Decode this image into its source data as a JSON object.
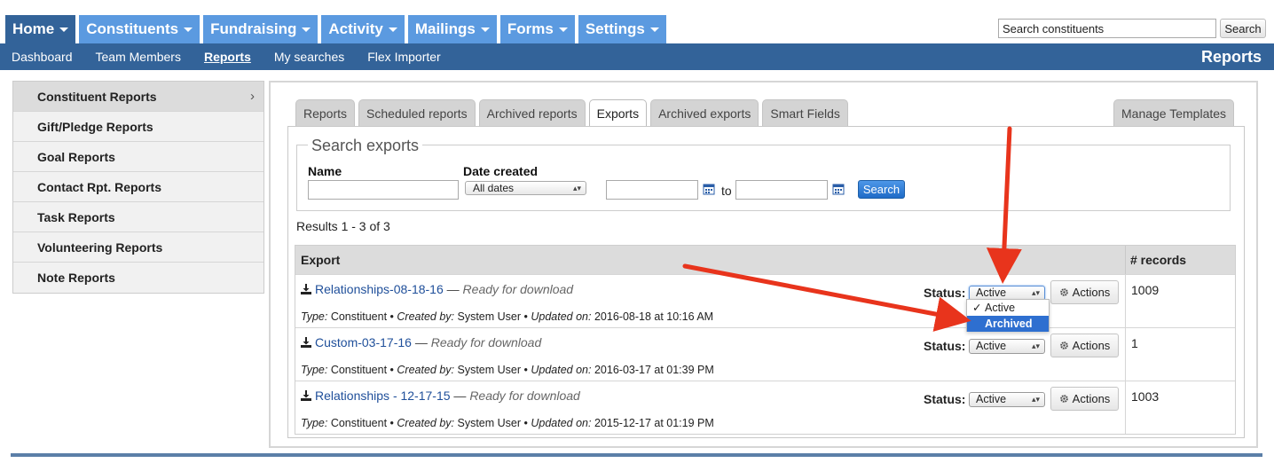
{
  "main_nav": {
    "tabs": [
      {
        "label": "Home",
        "active": true
      },
      {
        "label": "Constituents",
        "active": false
      },
      {
        "label": "Fundraising",
        "active": false
      },
      {
        "label": "Activity",
        "active": false
      },
      {
        "label": "Mailings",
        "active": false
      },
      {
        "label": "Forms",
        "active": false
      },
      {
        "label": "Settings",
        "active": false
      }
    ],
    "search_value": "Search constituents",
    "search_button": "Search"
  },
  "sub_nav": {
    "links": [
      "Dashboard",
      "Team Members",
      "Reports",
      "My searches",
      "Flex Importer"
    ],
    "active": "Reports",
    "title": "Reports"
  },
  "sidebar": {
    "items": [
      {
        "label": "Constituent Reports",
        "active": true,
        "chevron": "›"
      },
      {
        "label": "Gift/Pledge Reports",
        "active": false
      },
      {
        "label": "Goal Reports",
        "active": false
      },
      {
        "label": "Contact Rpt. Reports",
        "active": false
      },
      {
        "label": "Task Reports",
        "active": false
      },
      {
        "label": "Volunteering Reports",
        "active": false
      },
      {
        "label": "Note Reports",
        "active": false
      }
    ]
  },
  "tabs": {
    "items": [
      "Reports",
      "Scheduled reports",
      "Archived reports",
      "Exports",
      "Archived exports",
      "Smart Fields"
    ],
    "active": "Exports",
    "right": "Manage Templates"
  },
  "search_exports": {
    "legend": "Search exports",
    "name_label": "Name",
    "date_label": "Date created",
    "date_select": "All dates",
    "to_label": "to",
    "button": "Search"
  },
  "results_text": "Results 1 - 3 of 3",
  "table": {
    "col_export": "Export",
    "col_records": "# records",
    "status_label": "Status:",
    "actions_label": "Actions",
    "meta_labels": {
      "type": "Type:",
      "created_by": "Created by:",
      "updated_on": "Updated on:"
    },
    "rows": [
      {
        "name": "Relationships-08-18-16",
        "status_text": "Ready for download",
        "type": "Constituent",
        "created_by": "System User",
        "updated_on": "2016-08-18 at 10:16 AM",
        "status_value": "Active",
        "records": "1009"
      },
      {
        "name": "Custom-03-17-16",
        "status_text": "Ready for download",
        "type": "Constituent",
        "created_by": "System User",
        "updated_on": "2016-03-17 at 01:39 PM",
        "status_value": "Active",
        "records": "1"
      },
      {
        "name": "Relationships - 12-17-15",
        "status_text": "Ready for download",
        "type": "Constituent",
        "created_by": "System User",
        "updated_on": "2015-12-17 at 01:19 PM",
        "status_value": "Active",
        "records": "1003"
      }
    ]
  },
  "status_dropdown": {
    "options": [
      {
        "label": "Active",
        "checked": true
      },
      {
        "label": "Archived",
        "highlighted": true
      }
    ]
  },
  "colors": {
    "nav_blue": "#5b9ae0",
    "nav_dark": "#336399",
    "link": "#1f4f9a",
    "annotation_arrow": "#e8341c"
  }
}
